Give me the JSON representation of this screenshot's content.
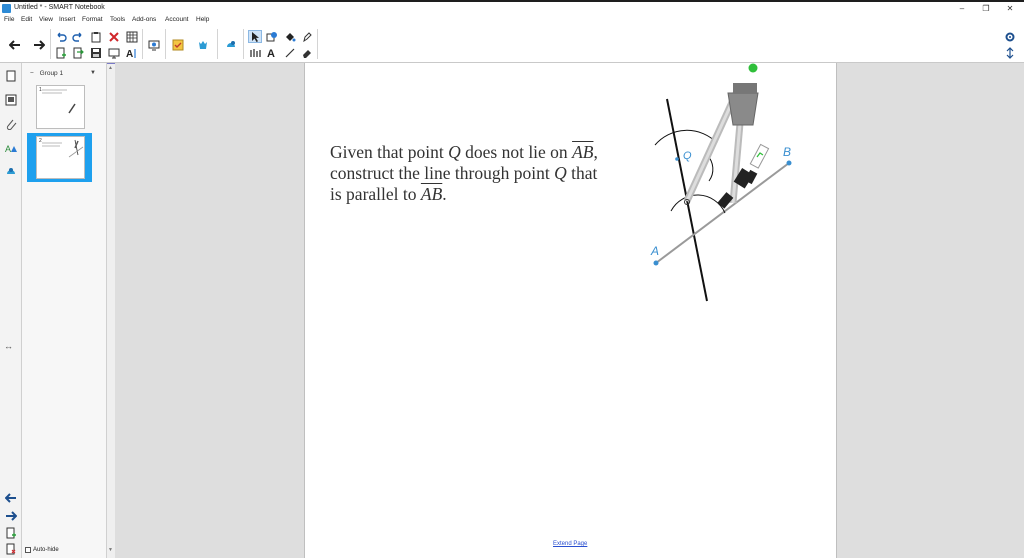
{
  "window": {
    "title": "Untitled * - SMART Notebook",
    "minimize": "–",
    "restore": "❐",
    "close": "✕"
  },
  "menu": [
    "File",
    "Edit",
    "View",
    "Insert",
    "Format",
    "Tools",
    "Add-ons",
    "Account",
    "Help"
  ],
  "toolbar": {
    "icons": [
      "back-icon",
      "forward-icon",
      "undo-icon",
      "redo-icon",
      "paste-icon",
      "delete-icon",
      "table-icon",
      "add-page-icon",
      "open-icon",
      "save-icon",
      "screen-shade-icon",
      "font-text-icon",
      "document-camera-icon",
      "response-icon",
      "add-ons-icon",
      "shapes-icon",
      "select-icon",
      "pen-icon",
      "fill-icon",
      "creative-pen-icon",
      "measurement-icon",
      "text-icon",
      "line-icon",
      "eraser-icon",
      "settings-icon",
      "expand-icon"
    ],
    "accent": "#2b7bd4"
  },
  "sorter": {
    "group_label": "Group 1",
    "group_collapse": "−",
    "pages": [
      "1",
      "2"
    ],
    "selected_page": "2",
    "autohide_label": "Auto-hide",
    "resize_glyph": "↔"
  },
  "page": {
    "problem_line1": "Given that point ",
    "problem_q1": "Q",
    "problem_line1b": " does not lie on ",
    "problem_ab1": "AB",
    "problem_line1c": ",",
    "problem_line2": "construct the line through point ",
    "problem_q2": "Q",
    "problem_line2b": " that",
    "problem_line3": "is parallel to ",
    "problem_ab2": "AB",
    "problem_line3b": ".",
    "point_a": "A",
    "point_b": "B",
    "point_q": "Q",
    "extend_link": "Extend Page",
    "line_color": "#9a9a9a",
    "point_color": "#3a8fd0"
  }
}
